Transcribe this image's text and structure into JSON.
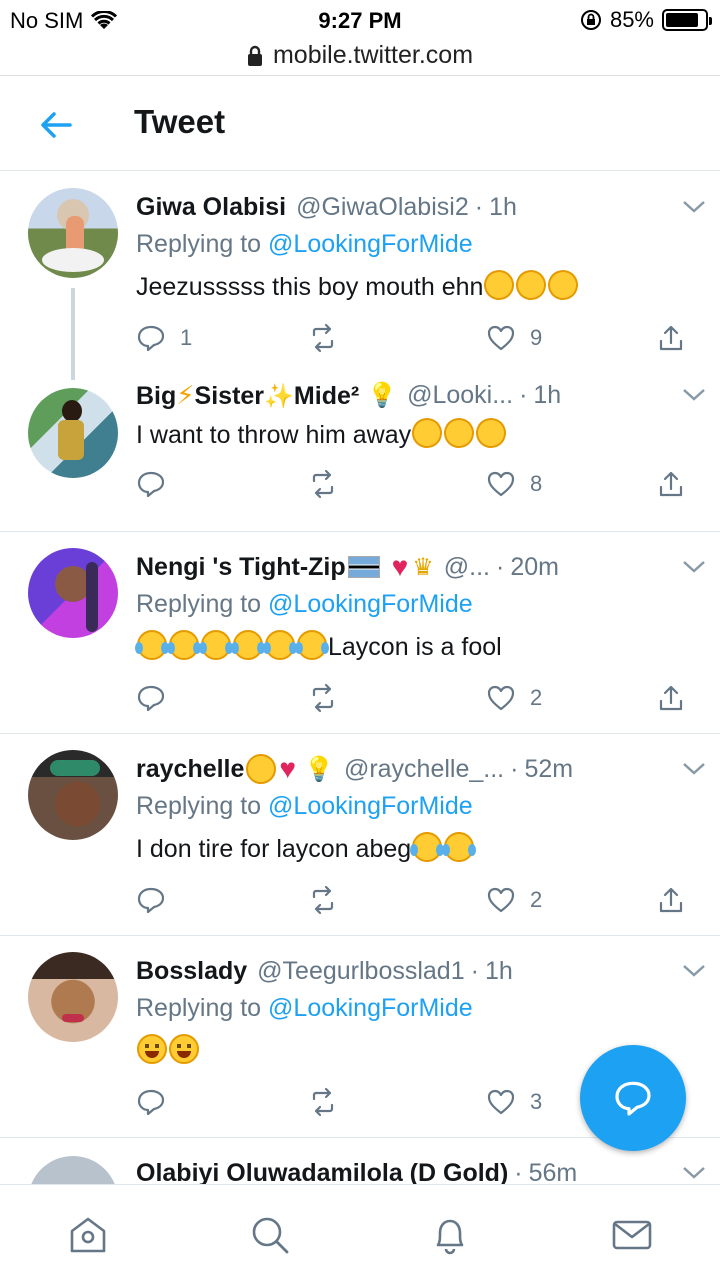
{
  "status": {
    "carrier": "No SIM",
    "time": "9:27 PM",
    "battery": "85%",
    "battery_level": 0.85
  },
  "browser": {
    "url": "mobile.twitter.com"
  },
  "header": {
    "title": "Tweet"
  },
  "tweets": [
    {
      "name": "Giwa Olabisi",
      "handle": "@GiwaOlabisi2",
      "time": "1h",
      "replying_prefix": "Replying to ",
      "replying_to": "@LookingForMide",
      "text": "Jeezusssss this boy mouth ehn",
      "text_emoji": [
        "rofl",
        "rofl",
        "rofl"
      ],
      "replies": "1",
      "retweets": "",
      "likes": "9"
    },
    {
      "name_parts": [
        "Big",
        "Sister",
        "Mide²"
      ],
      "handle": "@Looki...",
      "time": "1h",
      "text": "I want to throw him away",
      "text_emoji": [
        "rofl",
        "rofl",
        "rofl"
      ],
      "replies": "",
      "retweets": "",
      "likes": "8"
    },
    {
      "name": "Nengi 's Tight-Zip",
      "handle": "@...",
      "time": "20m",
      "replying_prefix": "Replying to ",
      "replying_to": "@LookingForMide",
      "text": "Laycon is a fool",
      "text_emoji": [
        "joy",
        "joy",
        "joy",
        "joy",
        "joy",
        "joy"
      ],
      "replies": "",
      "retweets": "",
      "likes": "2"
    },
    {
      "name": "raychelle",
      "handle": "@raychelle_...",
      "time": "52m",
      "replying_prefix": "Replying to ",
      "replying_to": "@LookingForMide",
      "text": "I don tire for laycon abeg",
      "text_emoji": [
        "joy",
        "joy"
      ],
      "replies": "",
      "retweets": "",
      "likes": "2"
    },
    {
      "name": "Bosslady",
      "handle": "@Teegurlbosslad1",
      "time": "1h",
      "replying_prefix": "Replying to ",
      "replying_to": "@LookingForMide",
      "text": "",
      "text_emoji": [
        "smile",
        "smile"
      ],
      "replies": "",
      "retweets": "",
      "likes": "3"
    },
    {
      "name": "Olabiyi Oluwadamilola (D Gold)",
      "time": "56m"
    }
  ],
  "icons": {
    "back": "arrow-left-icon",
    "caret": "chevron-down-icon",
    "reply": "reply-icon",
    "retweet": "retweet-icon",
    "like": "heart-icon",
    "share": "share-icon",
    "compose": "compose-reply-icon",
    "home": "home-icon",
    "search": "search-icon",
    "notifications": "bell-icon",
    "messages": "mail-icon"
  },
  "colors": {
    "accent": "#1da1f2",
    "muted": "#657786",
    "text": "#14171a"
  }
}
